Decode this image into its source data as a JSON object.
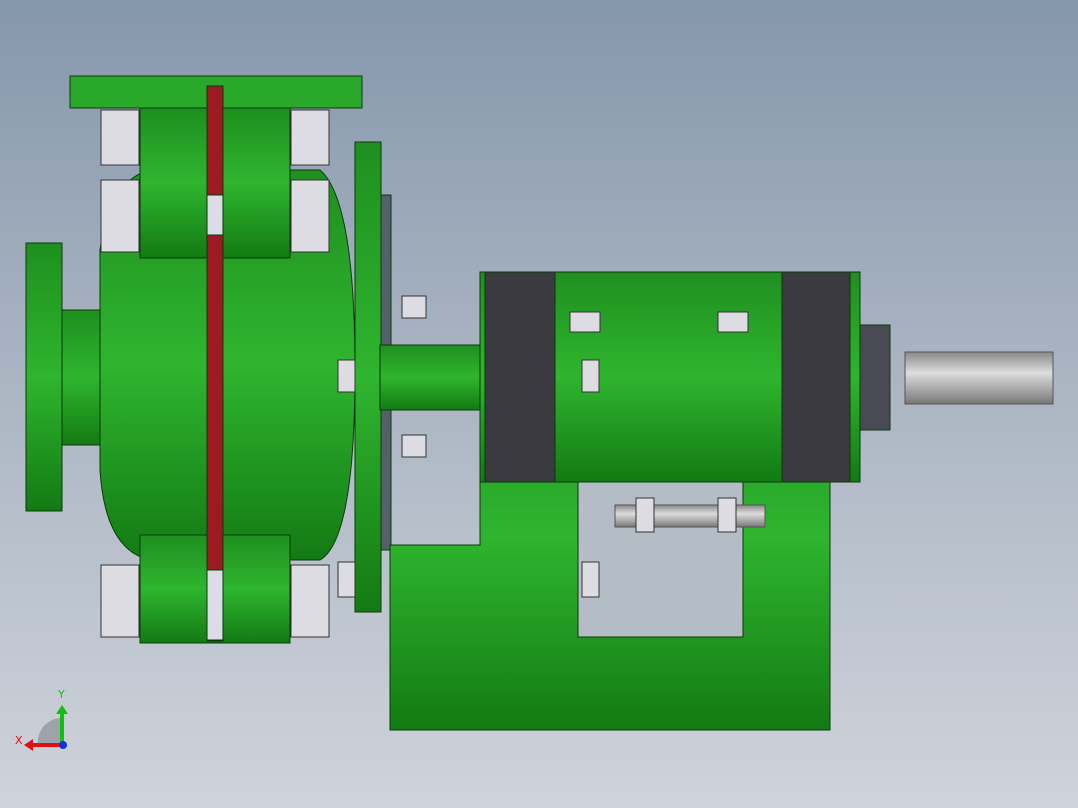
{
  "viewport": {
    "model": "slurry-pump-assembly"
  },
  "triad": {
    "x_label": "X",
    "y_label": "Y"
  },
  "colors": {
    "body": "#22a022",
    "body_dark": "#0f6a0f",
    "liner": "#9c1b22",
    "bolt": "#d8d8de",
    "bearing": "#3a3a40",
    "shaft": "#a8a8ac",
    "x_axis": "#e01010",
    "y_axis": "#10c010",
    "z_axis": "#1030e0"
  }
}
